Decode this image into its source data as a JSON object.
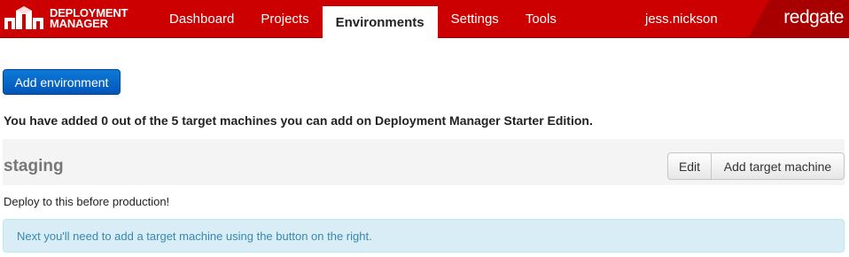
{
  "brand": {
    "line1": "DEPLOYMENT",
    "line2": "MANAGER",
    "icon": "package-boxes-icon"
  },
  "nav": {
    "items": [
      {
        "label": "Dashboard",
        "active": false
      },
      {
        "label": "Projects",
        "active": false
      },
      {
        "label": "Environments",
        "active": true
      },
      {
        "label": "Settings",
        "active": false
      },
      {
        "label": "Tools",
        "active": false
      }
    ],
    "user": "jess.nickson",
    "vendor": "redgate"
  },
  "colors": {
    "navbar": "#cc0000",
    "primary": "#0a6ed1",
    "info_bg": "#d9edf7",
    "info_text": "#3a87ad"
  },
  "page": {
    "add_environment_label": "Add environment",
    "notice": "You have added 0 out of the 5 target machines you can add on Deployment Manager Starter Edition."
  },
  "environment": {
    "name": "staging",
    "edit_label": "Edit",
    "add_target_label": "Add target machine",
    "description": "Deploy to this before production!",
    "info": "Next you'll need to add a target machine using the button on the right."
  }
}
